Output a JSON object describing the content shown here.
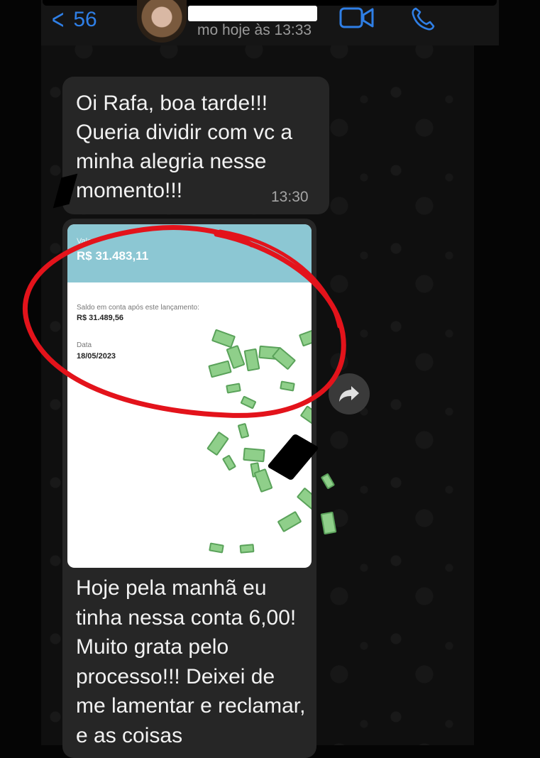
{
  "header": {
    "back_count": "56",
    "status": "mo hoje às 13:33"
  },
  "messages": [
    {
      "text": "Oi Rafa, boa tarde!!! Queria dividir com vc a minha alegria nesse momento!!!",
      "time": "13:30"
    },
    {
      "text": "Hoje pela manhã eu tinha nessa conta 6,00! Muito grata pelo processo!!! Deixei de me lamentar e reclamar, e as coisas"
    }
  ],
  "receipt": {
    "valor_label": "Valor",
    "valor": "R$ 31.483,11",
    "saldo_label": "Saldo em conta após este lançamento:",
    "saldo": "R$ 31.489,56",
    "data_label": "Data",
    "data": "18/05/2023"
  },
  "colors": {
    "accent": "#2f7fe6",
    "bubble": "#262626",
    "receipt_header": "#8cc7d3",
    "highlight": "#e3131b"
  },
  "icons": [
    "back-chevron-icon",
    "video-call-icon",
    "phone-call-icon",
    "forward-icon"
  ]
}
